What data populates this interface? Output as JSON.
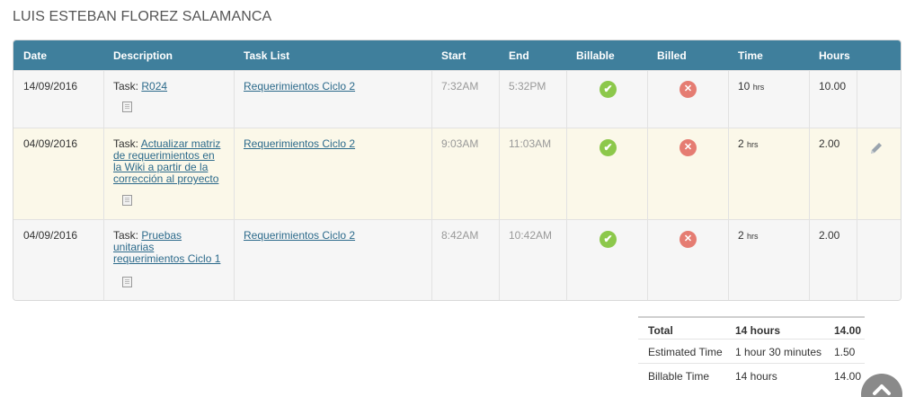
{
  "person_name": "LUIS ESTEBAN FLOREZ SALAMANCA",
  "columns": {
    "date": "Date",
    "description": "Description",
    "task_list": "Task List",
    "start": "Start",
    "end": "End",
    "billable": "Billable",
    "billed": "Billed",
    "time": "Time",
    "hours": "Hours"
  },
  "entries": [
    {
      "date": "14/09/2016",
      "task_prefix": "Task:",
      "task_link": "R024",
      "task_list": "Requerimientos Ciclo 2",
      "start": "7:32AM",
      "end": "5:32PM",
      "billable_icon": "check-icon",
      "billed_icon": "x-icon",
      "time_value": "10",
      "time_unit": "hrs",
      "hours": "10.00"
    },
    {
      "date": "04/09/2016",
      "task_prefix": "Task:",
      "task_link_lines": [
        "Actualizar matriz",
        "de requerimientos en",
        "la Wiki a partir de la",
        "corrección al proyecto"
      ],
      "task_list": "Requerimientos Ciclo 2",
      "start": "9:03AM",
      "end": "11:03AM",
      "billable_icon": "check-icon",
      "billed_icon": "x-icon",
      "time_value": "2",
      "time_unit": "hrs",
      "hours": "2.00",
      "row_icon": "pencil-icon"
    },
    {
      "date": "04/09/2016",
      "task_prefix": "Task:",
      "task_link_lines": [
        "Pruebas",
        "unitarias",
        "requerimientos Ciclo 1"
      ],
      "task_list": "Requerimientos Ciclo 2",
      "start": "8:42AM",
      "end": "10:42AM",
      "billable_icon": "check-icon",
      "billed_icon": "x-icon",
      "time_value": "2",
      "time_unit": "hrs",
      "hours": "2.00"
    }
  ],
  "summary": {
    "total_label": "Total",
    "total_text": "14 hours",
    "total_value": "14.00",
    "estimated_label": "Estimated Time",
    "estimated_text": "1 hour 30 minutes",
    "estimated_value": "1.50",
    "billable_label": "Billable Time",
    "billable_text": "14 hours",
    "billable_value": "14.00"
  },
  "colors": {
    "header": "#3f7f9c",
    "highlight_row": "#fbf8e9",
    "billable": "#8cc84b",
    "billed": "#e57c72",
    "link": "#2c6a8b"
  }
}
